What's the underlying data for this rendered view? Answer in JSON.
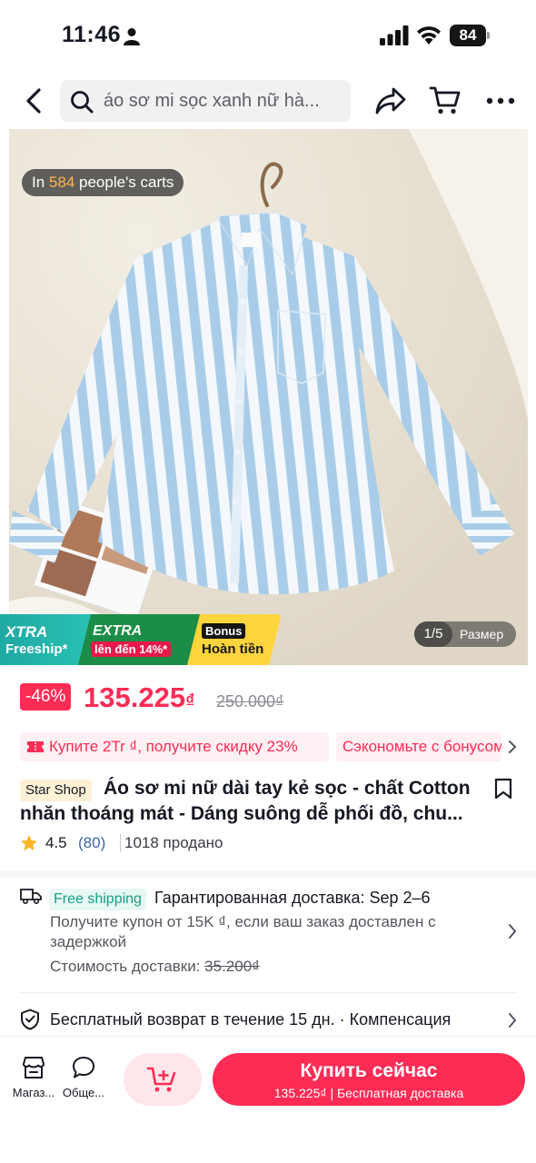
{
  "status_bar": {
    "time": "11:46",
    "battery": "84"
  },
  "nav": {
    "search_text": "áo sơ mi sọc xanh nữ hà..."
  },
  "image": {
    "carts_prefix": "In ",
    "carts_count": "584",
    "carts_suffix": " people's carts",
    "counter": "1/5",
    "size_label": "Размер"
  },
  "promo": {
    "xtra_label": "XTRA",
    "freeship_label": "Freeship*",
    "extra_label": "EXTRA",
    "extra_upto": "lên đến 14%*",
    "bonus_label": "Bonus",
    "cashback_label": "Hoàn tiền"
  },
  "price": {
    "discount": "-46%",
    "current": "135.225",
    "currency": "₫",
    "original": "250.000₫"
  },
  "coupons": [
    "Купите 2Tr ₫, получите скидку 23%",
    "Сэкономьте с бонусом"
  ],
  "product": {
    "shop_badge": "Star Shop",
    "title_line1": "Áo sơ mi nữ dài tay kẻ sọc - chất Cotton",
    "title_line2": "nhăn thoáng mát - Dáng suông dễ phối đồ, chu...",
    "rating": "4.5",
    "review_count": "(80)",
    "sold": "1018 продано"
  },
  "shipping": {
    "free_label": "Free shipping",
    "guarantee": "Гарантированная доставка: Sep 2–6",
    "coupon_note": "Получите купон от 15K ₫, если ваш заказ доставлен с задержкой",
    "cost_label": "Стоимость доставки: ",
    "cost_value": "35.200₫"
  },
  "returns": {
    "text": "Бесплатный возврат в течение 15 дн. · Компенсация"
  },
  "bottom_bar": {
    "shop_label": "Магаз...",
    "chat_label": "Обще...",
    "buy_label": "Купить сейчас",
    "buy_sub": "135.225₫ | Бесплатная доставка"
  },
  "colors": {
    "accent": "#fe2c55",
    "shirt_stripe": "#a9cde9",
    "badge_gold": "#ffb54a"
  }
}
